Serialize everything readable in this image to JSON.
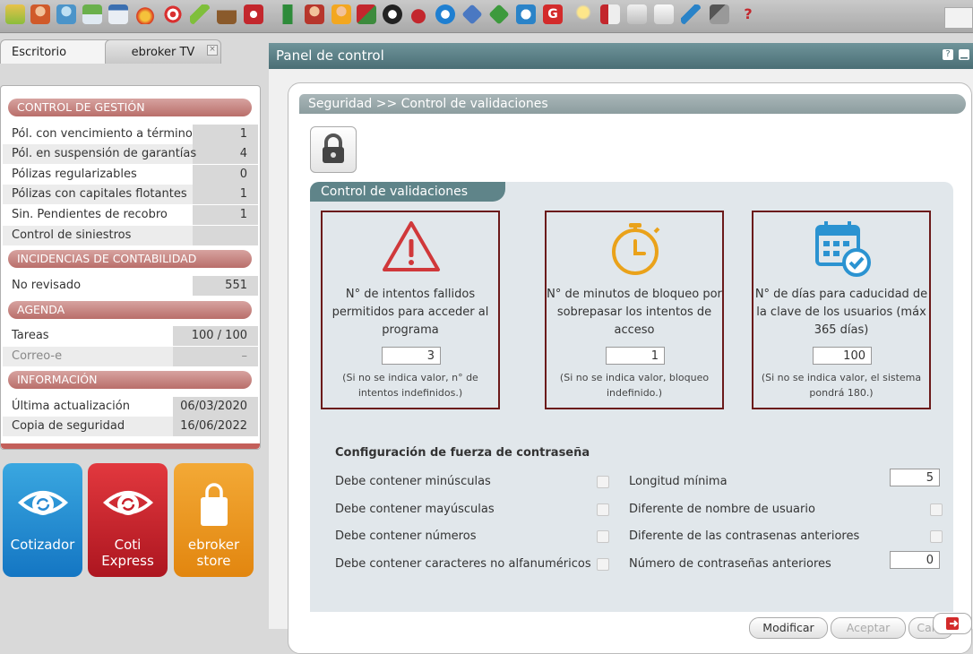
{
  "toolbar": {
    "icons": [
      "book-icon",
      "user-icon",
      "users-icon",
      "grid-icon",
      "window-icon",
      "fire-icon",
      "target-icon",
      "pencil-icon",
      "briefcase-icon",
      "alert-icon",
      "building-icon",
      "agent-icon",
      "person-icon",
      "money-icon",
      "euro-icon",
      "car-icon",
      "e-icon",
      "diamond-icon",
      "e-green-icon",
      "e-blue-icon",
      "g-icon",
      "bulb-icon",
      "chart-icon",
      "docs-icon",
      "doc-icon",
      "phone-icon",
      "tools-icon",
      "help-icon"
    ]
  },
  "tabs": {
    "escritorio": "Escritorio",
    "ebroker_tv": "ebroker TV",
    "close": "×"
  },
  "left": {
    "gestion": {
      "header": "CONTROL DE GESTIÓN",
      "rows": [
        {
          "label": "Pól. con vencimiento a término",
          "value": "1"
        },
        {
          "label": "Pól. en suspensión de garantías",
          "value": "4"
        },
        {
          "label": "Pólizas regularizables",
          "value": "0"
        },
        {
          "label": "Pólizas con capitales flotantes",
          "value": "1"
        },
        {
          "label": "Sin. Pendientes de recobro",
          "value": "1"
        },
        {
          "label": "Control de siniestros",
          "value": ""
        }
      ]
    },
    "contabilidad": {
      "header": "INCIDENCIAS DE CONTABILIDAD",
      "rows": [
        {
          "label": "No revisado",
          "value": "551"
        }
      ]
    },
    "agenda": {
      "header": "AGENDA",
      "rows": [
        {
          "label": "Tareas",
          "value": "100 / 100"
        },
        {
          "label": "Correo-e",
          "value": "–"
        }
      ]
    },
    "informacion": {
      "header": "INFORMACIÓN",
      "rows": [
        {
          "label": "Última actualización",
          "value": "06/03/2020"
        },
        {
          "label": "Copia de seguridad",
          "value": "16/06/2022"
        }
      ]
    }
  },
  "tiles": {
    "cotizador": {
      "line1": "Cotizador",
      "line2": ""
    },
    "coti": {
      "line1": "Coti",
      "line2": "Express"
    },
    "store": {
      "line1": "ebroker",
      "line2": "store"
    }
  },
  "panel": {
    "title": "Panel de control",
    "breadcrumb": "Seguridad >> Control de validaciones",
    "section_title": "Control de validaciones",
    "cards": [
      {
        "icon": "warning-icon",
        "desc": "N° de intentos fallidos permitidos para acceder al programa",
        "value": "3",
        "note": "(Si no se indica valor, n° de intentos indefinidos.)"
      },
      {
        "icon": "timer-icon",
        "desc": "N° de minutos de bloqueo por sobrepasar los intentos de acceso",
        "value": "1",
        "note": "(Si no se indica valor, bloqueo indefinido.)"
      },
      {
        "icon": "calendar-check-icon",
        "desc": "N° de días para caducidad de la clave de los usuarios (máx 365 días)",
        "value": "100",
        "note": "(Si no se indica valor, el sistema pondrá 180.)"
      }
    ],
    "strength": {
      "title": "Configuración de fuerza de contraseña",
      "left": [
        {
          "label": "Debe contener minúsculas",
          "checked": false
        },
        {
          "label": "Debe contener mayúsculas",
          "checked": false
        },
        {
          "label": "Debe contener números",
          "checked": false
        },
        {
          "label": "Debe contener caracteres no alfanuméricos",
          "checked": false
        }
      ],
      "right": [
        {
          "label": "Longitud mínima",
          "value": "5"
        },
        {
          "label": "Diferente de nombre de usuario",
          "checked": false
        },
        {
          "label": "Diferente de las contrasenas anteriores",
          "checked": false
        },
        {
          "label": "Número de contraseñas anteriores",
          "value": "0"
        }
      ]
    },
    "buttons": {
      "modify": "Modificar",
      "accept": "Aceptar",
      "cancel": "Canc"
    }
  },
  "colors": {
    "section_header": "#c27a76",
    "panel_title": "#5b7f85",
    "card_border": "#6b1a1a",
    "warning": "#d0383a",
    "timer": "#eaa21a",
    "calendar": "#2b93d1"
  }
}
